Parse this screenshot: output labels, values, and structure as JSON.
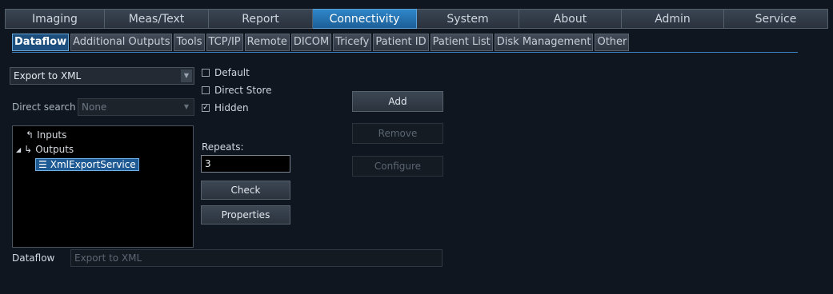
{
  "top_tabs": [
    "Imaging",
    "Meas/Text",
    "Report",
    "Connectivity",
    "System",
    "About",
    "Admin",
    "Service"
  ],
  "active_top_tab": "Connectivity",
  "sub_tabs": [
    "Dataflow",
    "Additional Outputs",
    "Tools",
    "TCP/IP",
    "Remote",
    "DICOM",
    "Tricefy",
    "Patient ID",
    "Patient List",
    "Disk Management",
    "Other"
  ],
  "active_sub_tab": "Dataflow",
  "dataflow_select": {
    "value": "Export to XML"
  },
  "direct_search": {
    "label": "Direct search",
    "value": "None"
  },
  "checkboxes": {
    "default": {
      "label": "Default",
      "checked": false
    },
    "direct_store": {
      "label": "Direct Store",
      "checked": false
    },
    "hidden": {
      "label": "Hidden",
      "checked": true
    }
  },
  "tree": {
    "inputs": "Inputs",
    "outputs": "Outputs",
    "service": "XmlExportService"
  },
  "repeats": {
    "label": "Repeats:",
    "value": "3"
  },
  "buttons": {
    "check": "Check",
    "properties": "Properties",
    "add": "Add",
    "remove": "Remove",
    "configure": "Configure"
  },
  "dataflow_name": {
    "label": "Dataflow",
    "value": "Export to XML"
  },
  "colors": {
    "accent": "#1c5f98",
    "selection": "#1e5a94",
    "background": "#0f1620"
  }
}
